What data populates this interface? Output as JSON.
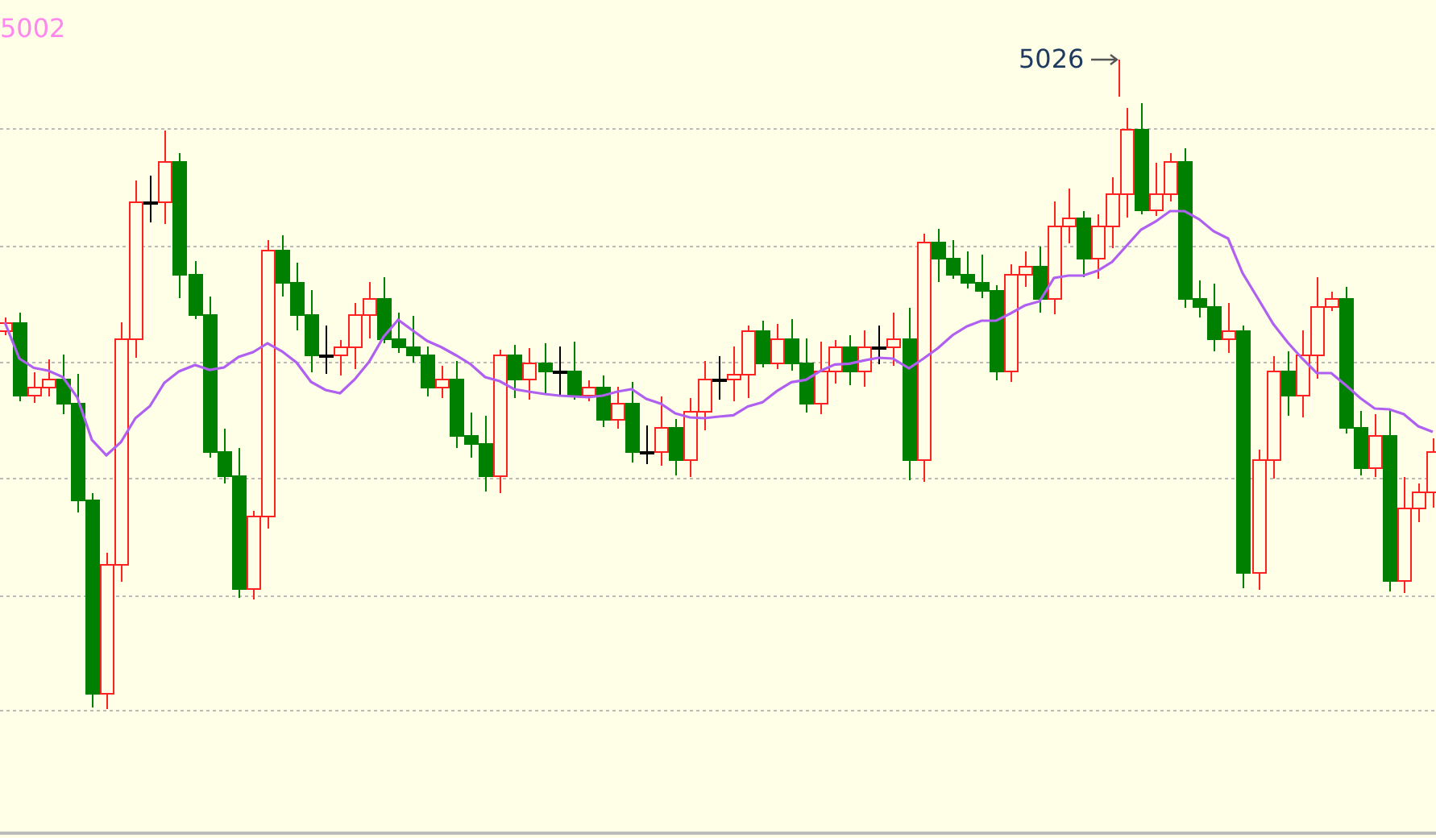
{
  "chart": {
    "indicator_label": "5002",
    "peak_label": "5026"
  }
}
